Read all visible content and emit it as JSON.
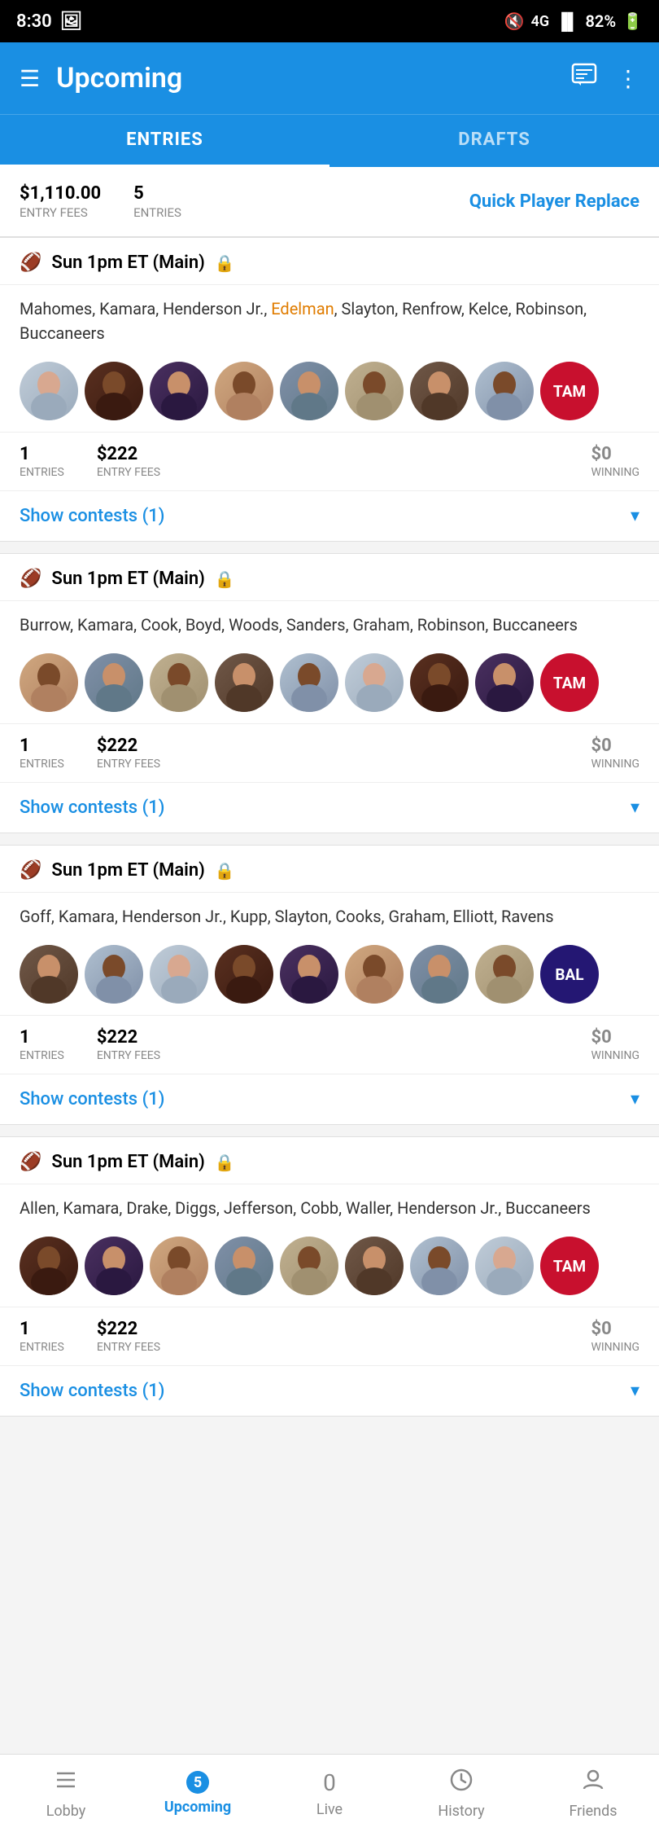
{
  "statusBar": {
    "time": "8:30",
    "battery": "82%"
  },
  "header": {
    "title": "Upcoming",
    "menuIcon": "☰",
    "chatIcon": "💬",
    "moreIcon": "⋮"
  },
  "tabs": [
    {
      "label": "ENTRIES",
      "active": true
    },
    {
      "label": "DRAFTS",
      "active": false
    }
  ],
  "summary": {
    "entryFees": "$1,110.00",
    "entryFeesLabel": "ENTRY FEES",
    "entries": "5",
    "entriesLabel": "ENTRIES",
    "quickReplace": "Quick Player Replace"
  },
  "entries": [
    {
      "id": 1,
      "gameTime": "Sun 1pm ET (Main)",
      "players": "Mahomes, Kamara, Henderson Jr.,",
      "playersHighlight": "Edelman",
      "playersRest": ", Slayton, Renfrow, Kelce, Robinson, Buccaneers",
      "entryCount": "1",
      "entryFee": "$222",
      "winning": "$0",
      "showContests": "Show contests (1)",
      "teamBadge": "TAM",
      "teamBadgeClass": "avatar-tam",
      "avatarColors": [
        "av1",
        "av2",
        "av3",
        "av4",
        "av5",
        "av6",
        "av7",
        "av8"
      ]
    },
    {
      "id": 2,
      "gameTime": "Sun 1pm ET (Main)",
      "players": "Burrow, Kamara, Cook, Boyd, Woods, Sanders, Graham, Robinson, Buccaneers",
      "playersHighlight": "",
      "playersRest": "",
      "entryCount": "1",
      "entryFee": "$222",
      "winning": "$0",
      "showContests": "Show contests (1)",
      "teamBadge": "TAM",
      "teamBadgeClass": "avatar-tam",
      "avatarColors": [
        "av8",
        "av2",
        "av3",
        "av5",
        "av6",
        "av1",
        "av7",
        "av4"
      ]
    },
    {
      "id": 3,
      "gameTime": "Sun 1pm ET (Main)",
      "players": "Goff, Kamara, Henderson Jr., Kupp, Slayton, Cooks, Graham, Elliott, Ravens",
      "playersHighlight": "",
      "playersRest": "",
      "entryCount": "1",
      "entryFee": "$222",
      "winning": "$0",
      "showContests": "Show contests (1)",
      "teamBadge": "BAL",
      "teamBadgeClass": "avatar-bal",
      "avatarColors": [
        "av8",
        "av2",
        "av5",
        "av1",
        "av6",
        "av3",
        "av7",
        "av4"
      ]
    },
    {
      "id": 4,
      "gameTime": "Sun 1pm ET (Main)",
      "players": "Allen, Kamara, Drake, Diggs, Jefferson, Cobb, Waller, Henderson Jr., Buccaneers",
      "playersHighlight": "",
      "playersRest": "",
      "entryCount": "1",
      "entryFee": "$222",
      "winning": "$0",
      "showContests": "Show contests (1)",
      "teamBadge": "TAM",
      "teamBadgeClass": "avatar-tam",
      "avatarColors": [
        "av1",
        "av2",
        "av3",
        "av4",
        "av5",
        "av6",
        "av7",
        "av8"
      ]
    }
  ],
  "bottomNav": [
    {
      "icon": "☰",
      "label": "Lobby",
      "active": false,
      "badge": null
    },
    {
      "icon": "5",
      "label": "Upcoming",
      "active": true,
      "badge": "5"
    },
    {
      "icon": "0",
      "label": "Live",
      "active": false,
      "badge": "0"
    },
    {
      "icon": "🕐",
      "label": "History",
      "active": false,
      "badge": null
    },
    {
      "icon": "👤",
      "label": "Friends",
      "active": false,
      "badge": null
    }
  ]
}
